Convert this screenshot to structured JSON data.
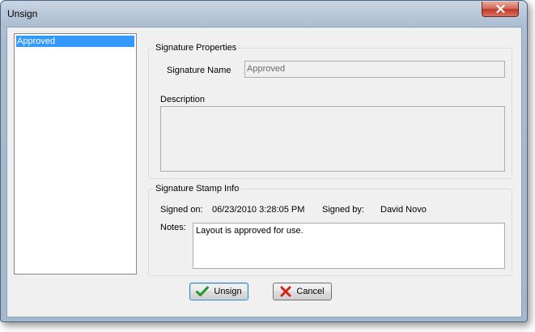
{
  "window": {
    "title": "Unsign",
    "close_icon": "close-icon",
    "close_color": "#c0392b"
  },
  "list": {
    "items": [
      {
        "label": "Approved",
        "selected": true
      }
    ],
    "selection_color": "#3399ff"
  },
  "signature_properties": {
    "group_label": "Signature Properties",
    "name_label": "Signature Name",
    "name_value": "Approved",
    "description_label": "Description",
    "description_value": ""
  },
  "stamp_info": {
    "group_label": "Signature Stamp Info",
    "signed_on_label": "Signed on:",
    "signed_on_value": "06/23/2010 3:28:05 PM",
    "signed_by_label": "Signed by:",
    "signed_by_value": "David Novo",
    "notes_label": "Notes:",
    "notes_value": "Layout is approved for use."
  },
  "buttons": {
    "unsign_label": "Unsign",
    "unsign_icon": "checkmark-icon",
    "cancel_label": "Cancel",
    "cancel_icon": "x-icon"
  }
}
